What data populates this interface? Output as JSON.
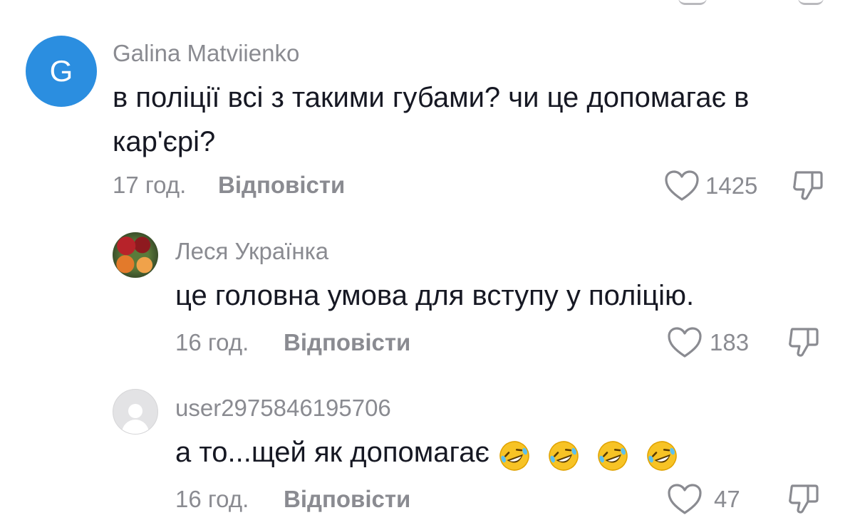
{
  "comments": [
    {
      "avatar_letter": "G",
      "username": "Galina Matviienko",
      "text_line1": "в поліції всі з такими губами? чи це допомагає в",
      "text_line2": "кар'єрі?",
      "time": "17 год.",
      "reply_label": "Відповісти",
      "likes": "1425",
      "avatar_color": "#2b8ee0"
    },
    {
      "username": "Леся Українка",
      "text": "це головна умова для вступу у поліцію.",
      "time": "16 год.",
      "reply_label": "Відповісти",
      "likes": "183"
    },
    {
      "username": "user2975846195706",
      "text": "а то...щей як допомагає",
      "emoji": [
        "rolling-on-floor-laughing",
        "rolling-on-floor-laughing",
        "rolling-on-floor-laughing",
        "rolling-on-floor-laughing"
      ],
      "time": "16 год.",
      "reply_label": "Відповісти",
      "likes": "47"
    }
  ],
  "icons": {
    "like": "heart-outline-icon",
    "dislike": "thumbs-down-outline-icon"
  },
  "colors": {
    "secondary_text": "#8a8b91",
    "primary_text": "#161823",
    "icon_stroke": "#8a8b91"
  }
}
